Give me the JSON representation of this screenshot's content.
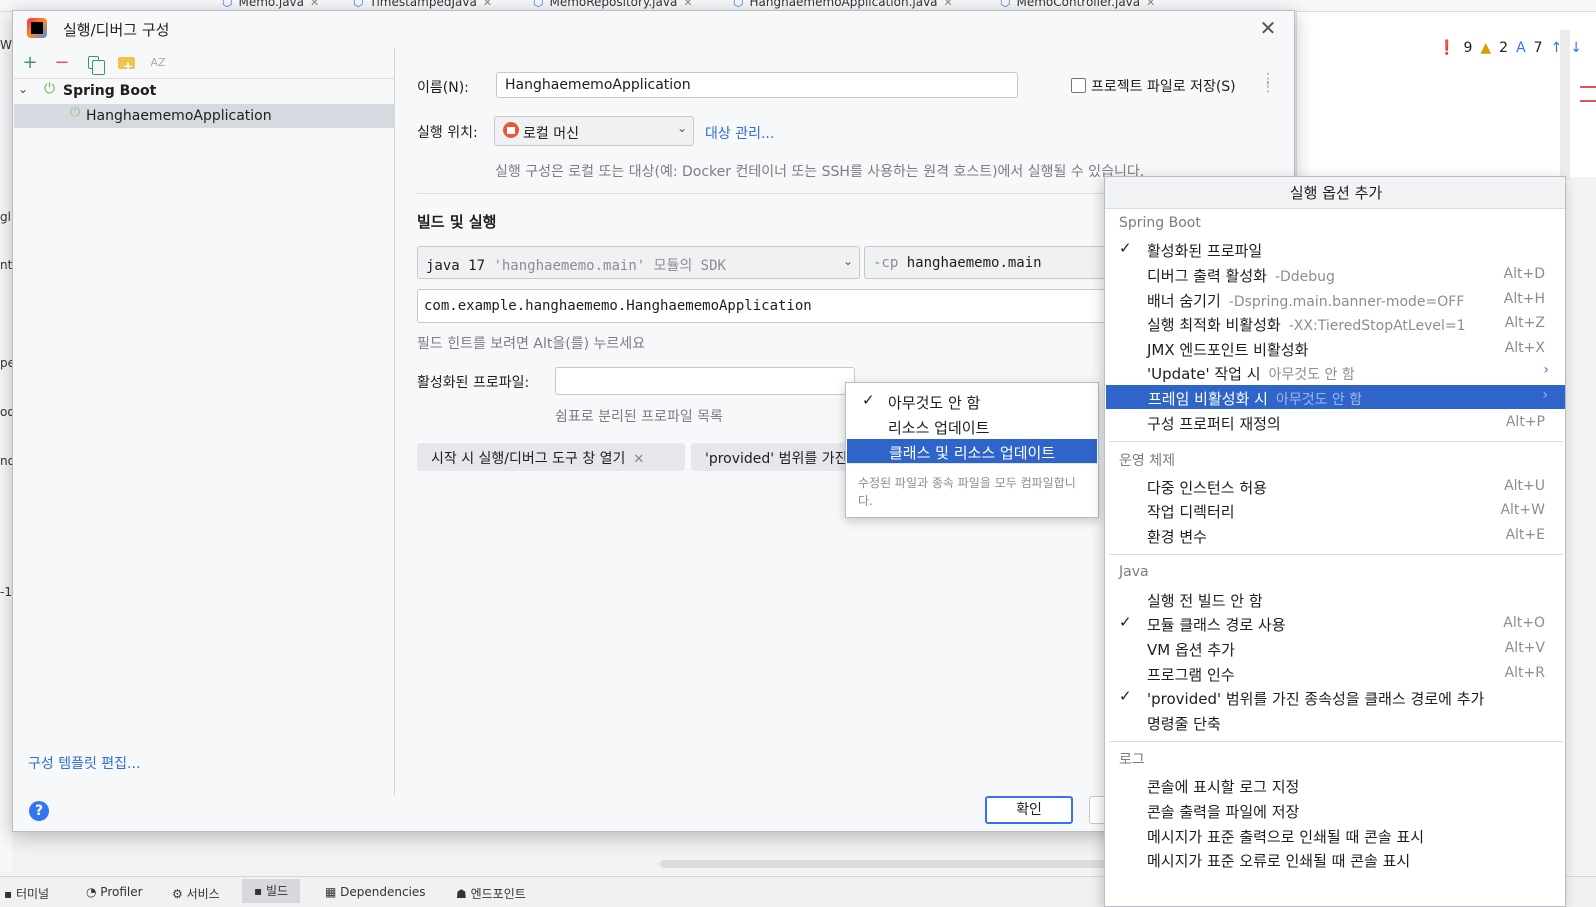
{
  "ide": {
    "tabs": [
      {
        "label": "Memo.java",
        "has_close": true
      },
      {
        "label": "TimestampedJava",
        "has_close": true
      },
      {
        "label": "MemoRepository.java",
        "has_close": true
      },
      {
        "label": "HanghaememoApplication.java",
        "has_close": true
      },
      {
        "label": "MemoController.java",
        "has_close": true
      }
    ],
    "inspection": {
      "errors": "9",
      "warnings": "2",
      "typos": "7"
    },
    "left_fragments": [
      "W",
      "gl",
      "nt",
      "pe",
      "oo",
      "no",
      "-1"
    ],
    "bottom_tools": [
      {
        "label": "터미널",
        "active": false
      },
      {
        "label": "Profiler",
        "active": false
      },
      {
        "label": "서비스",
        "active": false
      },
      {
        "label": "빌드",
        "active": true
      },
      {
        "label": "Dependencies",
        "active": false
      },
      {
        "label": "엔드포인트",
        "active": false
      }
    ]
  },
  "dialog": {
    "title": "실행/디버그 구성",
    "close_glyph": "✕",
    "toolbar": {
      "add": "+",
      "remove": "−",
      "sort": "AZ"
    },
    "tree": {
      "group_label": "Spring Boot",
      "items": [
        "HanghaememoApplication"
      ]
    },
    "edit_templates": "구성 템플릿 편집...",
    "name_label": "이름(N):",
    "name_value": "HanghaememoApplication",
    "store_as_project_file": {
      "label": "프로젝트 파일로 저장(S)",
      "checked": false
    },
    "run_on_label": "실행 위치:",
    "run_on_value": "로컬 머신",
    "manage_targets": "대상 관리...",
    "run_on_hint": "실행 구성은 로컬 또는 대상(예: Docker 컨테이너 또는 SSH를 사용하는 원격 호스트)에서 실행될 수 있습니다.",
    "build_section_title": "빌드 및 실행",
    "sdk": {
      "java": "java 17",
      "module": "'hanghaememo.main'",
      "suffix": "모듈의 SDK"
    },
    "classpath": {
      "flag": "-cp",
      "value": "hanghaememo.main"
    },
    "main_class": "com.example.hanghaememo.HanghaememoApplication",
    "field_hint": "필드 힌트를 보려면 Alt을(를) 누르세요",
    "active_profiles_label": "활성화된 프로파일:",
    "active_profiles_value": "",
    "active_profiles_hint": "쉼표로 분리된 프로파일 목록",
    "chips": [
      {
        "label": "시작 시 실행/디버그 도구 창 열기"
      },
      {
        "label": "'provided' 범위를 가진"
      }
    ],
    "ok_button": "확인",
    "help": "?"
  },
  "frame_popup": {
    "items": [
      {
        "label": "아무것도 안 함",
        "checked": true,
        "selected": false
      },
      {
        "label": "리소스 업데이트",
        "checked": false,
        "selected": false
      },
      {
        "label": "클래스 및 리소스 업데이트",
        "checked": false,
        "selected": true
      }
    ],
    "description": "수정된 파일과 종속 파일을 모두 컴파일합니다."
  },
  "options_popup": {
    "title": "실행 옵션 추가",
    "groups": [
      {
        "name": "Spring Boot",
        "items": [
          {
            "label": "활성화된 프로파일",
            "checked": true,
            "hint": "",
            "shortcut": ""
          },
          {
            "label": "디버그 출력 활성화",
            "checked": false,
            "hint": "-Ddebug",
            "shortcut": "Alt+D"
          },
          {
            "label": "배너 숨기기",
            "checked": false,
            "hint": "-Dspring.main.banner-mode=OFF",
            "shortcut": "Alt+H"
          },
          {
            "label": "실행 최적화 비활성화",
            "checked": false,
            "hint": "-XX:TieredStopAtLevel=1",
            "shortcut": "Alt+Z"
          },
          {
            "label": "JMX 엔드포인트 비활성화",
            "checked": false,
            "hint": "",
            "shortcut": "Alt+X"
          },
          {
            "label": "'Update' 작업 시",
            "checked": false,
            "hint": "아무것도 안 함",
            "shortcut": "",
            "submenu": true
          },
          {
            "label": "프레임 비활성화 시",
            "checked": false,
            "hint": "아무것도 안 함",
            "shortcut": "",
            "submenu": true,
            "selected": true
          },
          {
            "label": "구성 프로퍼티 재정의",
            "checked": false,
            "hint": "",
            "shortcut": "Alt+P"
          }
        ]
      },
      {
        "name": "운영 체제",
        "items": [
          {
            "label": "다중 인스턴스 허용",
            "checked": false,
            "hint": "",
            "shortcut": "Alt+U"
          },
          {
            "label": "작업 디렉터리",
            "checked": false,
            "hint": "",
            "shortcut": "Alt+W"
          },
          {
            "label": "환경 변수",
            "checked": false,
            "hint": "",
            "shortcut": "Alt+E"
          }
        ]
      },
      {
        "name": "Java",
        "items": [
          {
            "label": "실행 전 빌드 안 함",
            "checked": false,
            "hint": "",
            "shortcut": ""
          },
          {
            "label": "모듈 클래스 경로 사용",
            "checked": true,
            "hint": "",
            "shortcut": "Alt+O"
          },
          {
            "label": "VM 옵션 추가",
            "checked": false,
            "hint": "",
            "shortcut": "Alt+V"
          },
          {
            "label": "프로그램 인수",
            "checked": false,
            "hint": "",
            "shortcut": "Alt+R"
          },
          {
            "label": "'provided' 범위를 가진 종속성을 클래스 경로에 추가",
            "checked": true,
            "hint": "",
            "shortcut": ""
          },
          {
            "label": "명령줄 단축",
            "checked": false,
            "hint": "",
            "shortcut": ""
          }
        ]
      },
      {
        "name": "로그",
        "items": [
          {
            "label": "콘솔에 표시할 로그 지정",
            "checked": false,
            "hint": "",
            "shortcut": ""
          },
          {
            "label": "콘솔 출력을 파일에 저장",
            "checked": false,
            "hint": "",
            "shortcut": ""
          },
          {
            "label": "메시지가 표준 출력으로 인쇄될 때 콘솔 표시",
            "checked": false,
            "hint": "",
            "shortcut": ""
          },
          {
            "label": "메시지가 표준 오류로 인쇄될 때 콘솔 표시",
            "checked": false,
            "hint": "",
            "shortcut": ""
          }
        ]
      }
    ]
  },
  "colors": {
    "accent": "#3574f0",
    "selection": "#2f65ca",
    "spring_green": "#6db33f",
    "error": "#e05555",
    "warning": "#d6a000"
  }
}
